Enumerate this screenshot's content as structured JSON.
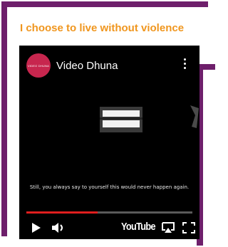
{
  "heading": "I choose to live without violence",
  "video": {
    "channel_avatar_text": "VIDEO DHUNA",
    "channel_name": "Video Dhuna",
    "caption": "Still, you always say to yourself this would never happen again.",
    "progress": 0.43,
    "youtube_label": "YouTube"
  },
  "colors": {
    "frame": "#6e1f6b",
    "heading": "#f0961e",
    "progress": "#e01e1e",
    "avatar": "#c7264e"
  },
  "icons": [
    "kebab-menu-icon",
    "play-icon",
    "volume-icon",
    "airplay-icon",
    "fullscreen-icon"
  ]
}
